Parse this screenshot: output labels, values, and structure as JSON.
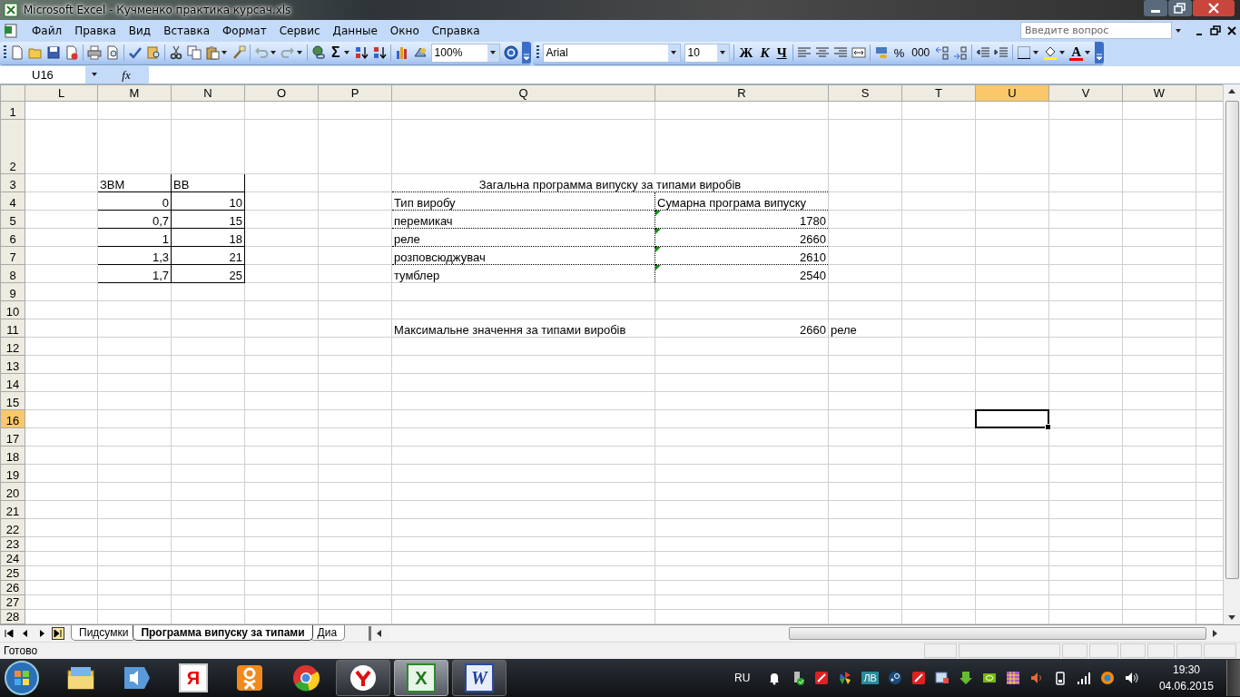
{
  "window": {
    "title": "Microsoft Excel - Кучменко практика курсач.xls"
  },
  "menu": [
    "Файл",
    "Правка",
    "Вид",
    "Вставка",
    "Формат",
    "Сервис",
    "Данные",
    "Окно",
    "Справка"
  ],
  "help_search": {
    "placeholder": "Введите вопрос"
  },
  "standard_toolbar": {
    "sum": "Σ",
    "zoom": "100%"
  },
  "formatting_toolbar": {
    "font": "Arial",
    "size": "10",
    "bold": "Ж",
    "italic": "К",
    "underline": "Ч",
    "percent": "%",
    "thousands": "000",
    "font_color": "A"
  },
  "name_box": "U16",
  "formula_label": "fx",
  "columns": [
    {
      "label": "L",
      "selected": false
    },
    {
      "label": "M",
      "selected": false
    },
    {
      "label": "N",
      "selected": false
    },
    {
      "label": "O",
      "selected": false
    },
    {
      "label": "P",
      "selected": false
    },
    {
      "label": "Q",
      "selected": false
    },
    {
      "label": "R",
      "selected": false
    },
    {
      "label": "S",
      "selected": false
    },
    {
      "label": "T",
      "selected": false
    },
    {
      "label": "U",
      "selected": true
    },
    {
      "label": "V",
      "selected": false
    },
    {
      "label": "W",
      "selected": false
    }
  ],
  "rows": [
    {
      "label": "1",
      "selected": false,
      "cells": []
    },
    {
      "label": "2",
      "selected": false,
      "cells": []
    },
    {
      "label": "3",
      "selected": false,
      "cells": [
        null,
        {
          "text": "ЗВМ",
          "kind": "text",
          "boxed": true
        },
        {
          "text": "ВВ",
          "kind": "text",
          "boxed": true
        },
        null,
        null,
        {
          "text": "Загальна программа випуску за типами виробів",
          "kind": "merged-title",
          "dotted": true
        }
      ]
    },
    {
      "label": "4",
      "selected": false,
      "cells": [
        null,
        {
          "text": "0",
          "kind": "number",
          "boxed": true
        },
        {
          "text": "10",
          "kind": "number",
          "boxed": true
        },
        null,
        null,
        {
          "text": "Тип виробу",
          "kind": "text",
          "dotted": true
        },
        {
          "text": "Сумарна програма випуску",
          "kind": "text",
          "dotted": true
        }
      ]
    },
    {
      "label": "5",
      "selected": false,
      "cells": [
        null,
        {
          "text": "0,7",
          "kind": "number",
          "boxed": true
        },
        {
          "text": "15",
          "kind": "number",
          "boxed": true
        },
        null,
        null,
        {
          "text": "перемикач",
          "kind": "text",
          "dotted": true
        },
        {
          "text": "1780",
          "kind": "number",
          "dotted": true,
          "error_flag": true
        }
      ]
    },
    {
      "label": "6",
      "selected": false,
      "cells": [
        null,
        {
          "text": "1",
          "kind": "number",
          "boxed": true
        },
        {
          "text": "18",
          "kind": "number",
          "boxed": true
        },
        null,
        null,
        {
          "text": "реле",
          "kind": "text",
          "dotted": true
        },
        {
          "text": "2660",
          "kind": "number",
          "dotted": true,
          "error_flag": true
        }
      ]
    },
    {
      "label": "7",
      "selected": false,
      "cells": [
        null,
        {
          "text": "1,3",
          "kind": "number",
          "boxed": true
        },
        {
          "text": "21",
          "kind": "number",
          "boxed": true
        },
        null,
        null,
        {
          "text": "розповсюджувач",
          "kind": "text",
          "dotted": true
        },
        {
          "text": "2610",
          "kind": "number",
          "dotted": true,
          "error_flag": true
        }
      ]
    },
    {
      "label": "8",
      "selected": false,
      "cells": [
        null,
        {
          "text": "1,7",
          "kind": "number",
          "boxed": true
        },
        {
          "text": "25",
          "kind": "number",
          "boxed": true
        },
        null,
        null,
        {
          "text": "тумблер",
          "kind": "text",
          "dotted": true
        },
        {
          "text": "2540",
          "kind": "number",
          "dotted": true,
          "error_flag": true
        }
      ]
    },
    {
      "label": "9",
      "selected": false,
      "cells": []
    },
    {
      "label": "10",
      "selected": false,
      "cells": []
    },
    {
      "label": "11",
      "selected": false,
      "cells": [
        null,
        null,
        null,
        null,
        null,
        {
          "text": "Максимальне значення за типами виробів",
          "kind": "text"
        },
        {
          "text": "2660",
          "kind": "number"
        },
        {
          "text": "реле",
          "kind": "text"
        }
      ]
    },
    {
      "label": "12",
      "selected": false,
      "cells": []
    },
    {
      "label": "13",
      "selected": false,
      "cells": []
    },
    {
      "label": "14",
      "selected": false,
      "cells": []
    },
    {
      "label": "15",
      "selected": false,
      "cells": []
    },
    {
      "label": "16",
      "selected": true,
      "cells": []
    },
    {
      "label": "17",
      "selected": false,
      "cells": []
    },
    {
      "label": "18",
      "selected": false,
      "cells": []
    },
    {
      "label": "19",
      "selected": false,
      "cells": []
    },
    {
      "label": "20",
      "selected": false,
      "cells": []
    },
    {
      "label": "21",
      "selected": false,
      "cells": []
    },
    {
      "label": "22",
      "selected": false,
      "cells": []
    },
    {
      "label": "23",
      "selected": false,
      "cells": []
    },
    {
      "label": "24",
      "selected": false,
      "cells": []
    },
    {
      "label": "25",
      "selected": false,
      "cells": []
    },
    {
      "label": "26",
      "selected": false,
      "cells": []
    },
    {
      "label": "27",
      "selected": false,
      "cells": []
    },
    {
      "label": "28",
      "selected": false,
      "cells": []
    }
  ],
  "sheet_tabs": [
    {
      "label": "Пидсумки",
      "selected": false
    },
    {
      "label": "Программа випуску за типами",
      "selected": true
    },
    {
      "label": "Диа",
      "selected": false
    }
  ],
  "status_bar": "Готово",
  "taskbar": {
    "apps": [
      {
        "kind": "explorer",
        "running": false,
        "selected": false
      },
      {
        "kind": "media",
        "running": false,
        "selected": false
      },
      {
        "kind": "yandex",
        "glyph": "Я",
        "running": false,
        "selected": false
      },
      {
        "kind": "ok",
        "running": false,
        "selected": false
      },
      {
        "kind": "chrome",
        "running": false,
        "selected": false
      },
      {
        "kind": "ybrowser",
        "running": true,
        "selected": false
      },
      {
        "kind": "excel",
        "glyph": "X",
        "running": true,
        "selected": true
      },
      {
        "kind": "word",
        "glyph": "W",
        "running": true,
        "selected": false
      }
    ],
    "language": "RU",
    "tray_label": "ЛВ",
    "time": "19:30",
    "date": "04.06.2015"
  }
}
